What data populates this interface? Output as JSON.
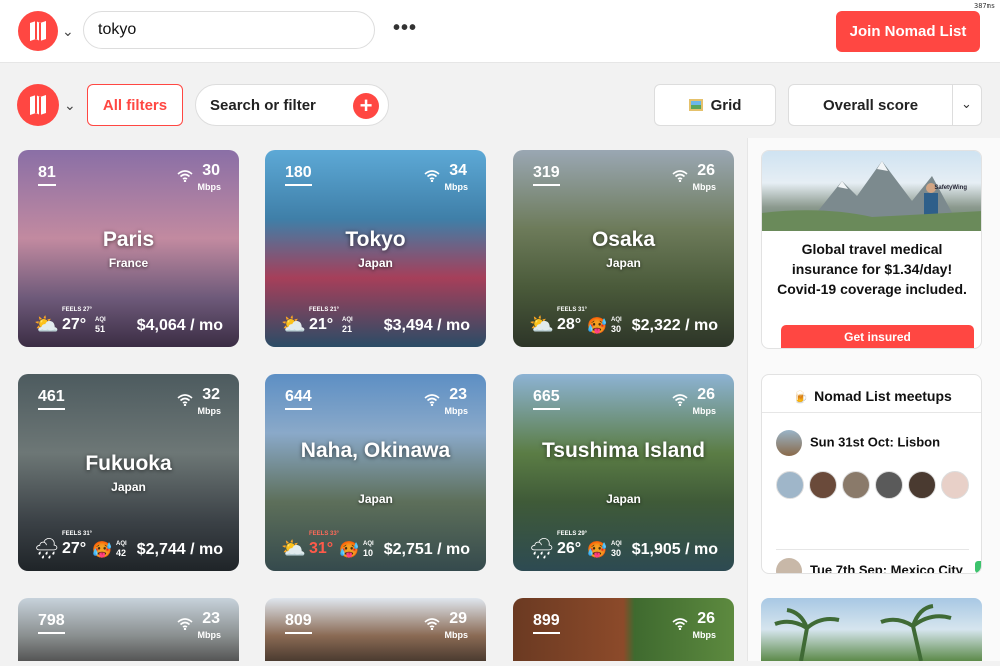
{
  "header": {
    "search_value": "tokyo",
    "more_label": "•••",
    "join_label": "Join Nomad List",
    "timer": "387ms"
  },
  "filters": {
    "all_filters_label": "All filters",
    "search_placeholder": "Search or filter",
    "grid_label": "Grid",
    "sort_label": "Overall score"
  },
  "cities": [
    {
      "rank": "81",
      "city": "Paris",
      "country": "France",
      "speed": "30",
      "unit": "Mbps",
      "feels": "FEELS 27°",
      "temp": "27°",
      "aqi_label": "AQI",
      "aqi": "51",
      "cost": "$4,064 / mo",
      "weather": "⛅"
    },
    {
      "rank": "180",
      "city": "Tokyo",
      "country": "Japan",
      "speed": "34",
      "unit": "Mbps",
      "feels": "FEELS 21°",
      "temp": "21°",
      "aqi_label": "AQI",
      "aqi": "21",
      "cost": "$3,494 / mo",
      "weather": "⛅"
    },
    {
      "rank": "319",
      "city": "Osaka",
      "country": "Japan",
      "speed": "26",
      "unit": "Mbps",
      "feels": "FEELS 31°",
      "temp": "28°",
      "aqi_label": "AQI",
      "aqi": "30",
      "cost": "$2,322 / mo",
      "weather": "⛅"
    },
    {
      "rank": "461",
      "city": "Fukuoka",
      "country": "Japan",
      "speed": "32",
      "unit": "Mbps",
      "feels": "FEELS 31°",
      "temp": "27°",
      "aqi_label": "AQI",
      "aqi": "42",
      "cost": "$2,744 / mo",
      "weather": "🌧"
    },
    {
      "rank": "644",
      "city": "Naha, Okinawa",
      "country": "Japan",
      "speed": "23",
      "unit": "Mbps",
      "feels": "FEELS 33°",
      "temp": "31°",
      "aqi_label": "AQI",
      "aqi": "10",
      "cost": "$2,751 / mo",
      "weather": "⛅"
    },
    {
      "rank": "665",
      "city": "Tsushima Island",
      "country": "Japan",
      "speed": "26",
      "unit": "Mbps",
      "feels": "FEELS 29°",
      "temp": "26°",
      "aqi_label": "AQI",
      "aqi": "30",
      "cost": "$1,905 / mo",
      "weather": "🌧"
    },
    {
      "rank": "798",
      "speed": "23",
      "unit": "Mbps"
    },
    {
      "rank": "809",
      "speed": "29",
      "unit": "Mbps"
    },
    {
      "rank": "899",
      "speed": "26",
      "unit": "Mbps"
    }
  ],
  "ad": {
    "brand": "SafetyWing",
    "text": "Global travel medical insurance for $1.34/day! Covid-19 coverage included.",
    "cta": "Get insured"
  },
  "meetups": {
    "title": "Nomad List meetups",
    "events": [
      {
        "label": "Sun 31st Oct: Lisbon"
      },
      {
        "label": "Tue 7th Sep: Mexico City"
      }
    ],
    "avatar_count": 6
  },
  "colors": {
    "accent": "#ff4742",
    "background": "#f2f2f2"
  }
}
